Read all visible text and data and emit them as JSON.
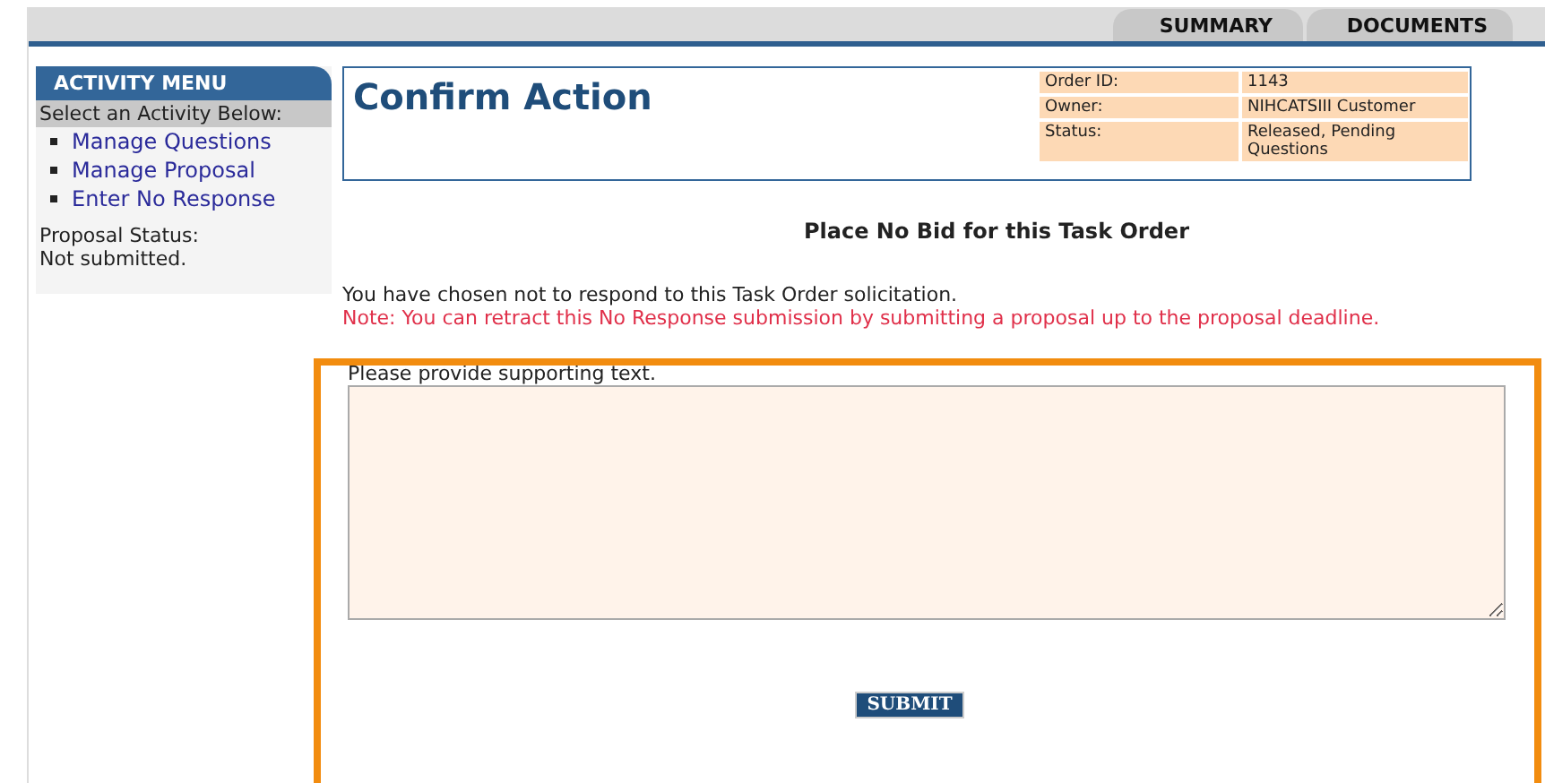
{
  "tabs": [
    {
      "label": "SUMMARY"
    },
    {
      "label": "DOCUMENTS"
    }
  ],
  "sidebar": {
    "title": "ACTIVITY MENU",
    "subtitle": "Select an Activity Below:",
    "items": [
      {
        "label": "Manage Questions"
      },
      {
        "label": "Manage Proposal"
      },
      {
        "label": "Enter No Response"
      }
    ],
    "status_label": "Proposal Status:",
    "status_value": "Not submitted."
  },
  "header": {
    "title": "Confirm Action",
    "details": [
      {
        "label": "Order ID:",
        "value": "1143"
      },
      {
        "label": "Owner:",
        "value": "NIHCATSIII Customer"
      },
      {
        "label": "Status:",
        "value": "Released, Pending Questions"
      }
    ]
  },
  "heading": "Place No Bid for this Task Order",
  "message": "You have chosen not to respond to this Task Order solicitation.",
  "note": "Note: You can retract this No Response submission by submitting a proposal up to the proposal deadline.",
  "form": {
    "label": "Please provide supporting text.",
    "button": "SUBMIT"
  }
}
